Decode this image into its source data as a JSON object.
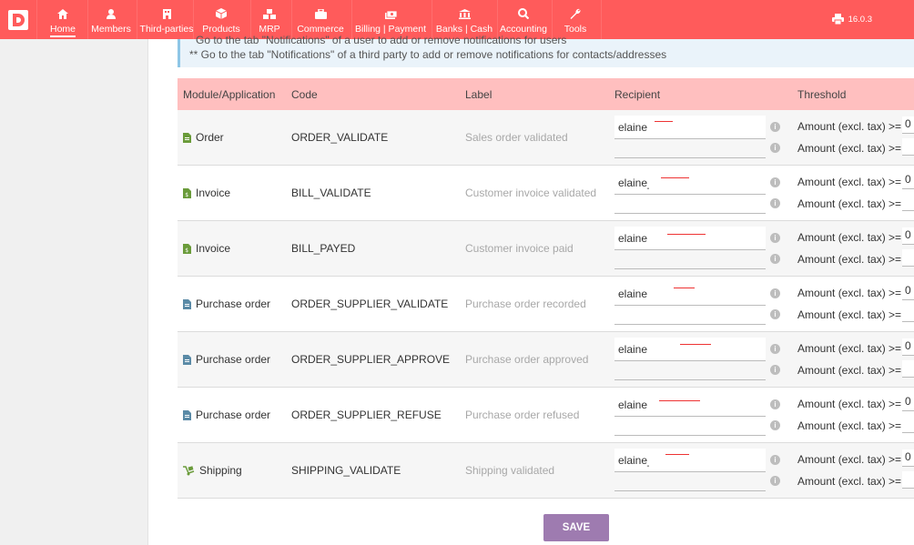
{
  "brand": {
    "logo_letter": "D",
    "color": "#ff5b5b"
  },
  "nav": {
    "items": [
      {
        "label": "Home",
        "icon": "home-icon"
      },
      {
        "label": "Members",
        "icon": "user-icon"
      },
      {
        "label": "Third-parties",
        "icon": "building-icon"
      },
      {
        "label": "Products",
        "icon": "cube-icon"
      },
      {
        "label": "MRP",
        "icon": "cubes-icon"
      },
      {
        "label": "Commerce",
        "icon": "briefcase-icon"
      },
      {
        "label": "Billing | Payment",
        "icon": "money-icon"
      },
      {
        "label": "Banks | Cash",
        "icon": "bank-icon"
      },
      {
        "label": "Accounting",
        "icon": "search-dollar-icon"
      },
      {
        "label": "Tools",
        "icon": "wrench-icon"
      }
    ],
    "version": "16.0.3"
  },
  "info": {
    "line1": "Go to the tab \"Notifications\" of a user to add or remove notifications for users",
    "line2": "** Go to the tab \"Notifications\" of a third party to add or remove notifications for contacts/addresses"
  },
  "table": {
    "headers": {
      "module": "Module/Application",
      "code": "Code",
      "label": "Label",
      "recipient": "Recipient",
      "threshold": "Threshold"
    },
    "threshold_label": "Amount (excl. tax) >=",
    "rows": [
      {
        "module": "Order",
        "module_icon": "order-icon",
        "code": "ORDER_VALIDATE",
        "label": "Sales order validated",
        "recipient": "elaine",
        "threshold": "0"
      },
      {
        "module": "Invoice",
        "module_icon": "invoice-icon",
        "code": "BILL_VALIDATE",
        "label": "Customer invoice validated",
        "recipient": "elaine_",
        "threshold": "0"
      },
      {
        "module": "Invoice",
        "module_icon": "invoice-icon",
        "code": "BILL_PAYED",
        "label": "Customer invoice paid",
        "recipient": "elaine",
        "threshold": "0"
      },
      {
        "module": "Purchase order",
        "module_icon": "supplier-order-icon",
        "code": "ORDER_SUPPLIER_VALIDATE",
        "label": "Purchase order recorded",
        "recipient": "elaine",
        "threshold": "0"
      },
      {
        "module": "Purchase order",
        "module_icon": "supplier-order-icon",
        "code": "ORDER_SUPPLIER_APPROVE",
        "label": "Purchase order approved",
        "recipient": "elaine",
        "threshold": "0"
      },
      {
        "module": "Purchase order",
        "module_icon": "supplier-order-icon",
        "code": "ORDER_SUPPLIER_REFUSE",
        "label": "Purchase order refused",
        "recipient": "elaine",
        "threshold": "0"
      },
      {
        "module": "Shipping",
        "module_icon": "dolly-icon",
        "code": "SHIPPING_VALIDATE",
        "label": "Shipping validated",
        "recipient": "elaine_",
        "threshold": "0"
      }
    ]
  },
  "save_label": "SAVE"
}
